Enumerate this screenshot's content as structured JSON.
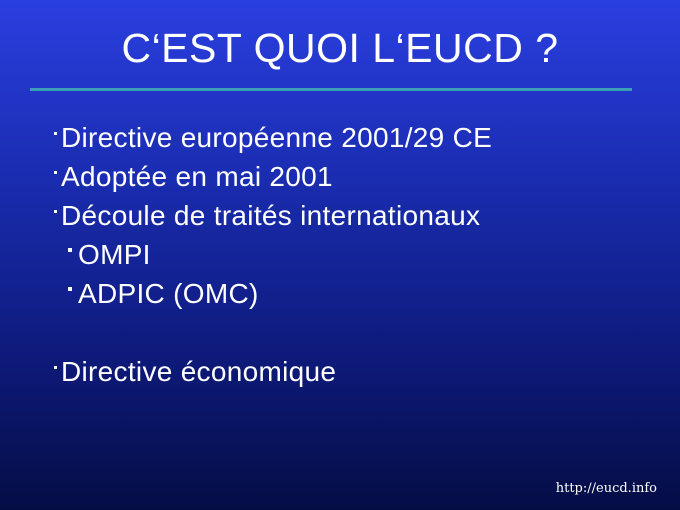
{
  "slide": {
    "title": "C‘EST QUOI L‘EUCD ?",
    "bullets": [
      {
        "text": "Directive européenne 2001/29 CE",
        "level": 1
      },
      {
        "text": "Adoptée en mai 2001",
        "level": 1
      },
      {
        "text": "Découle de traités internationaux",
        "level": 1
      },
      {
        "text": "OMPI",
        "level": 2
      },
      {
        "text": "ADPIC (OMC)",
        "level": 2
      },
      {
        "text": "Directive économique",
        "level": 1
      }
    ],
    "footer": "http://eucd.info"
  },
  "colors": {
    "background_top": "#2a3fe0",
    "background_bottom": "#050d45",
    "rule": "#3aa0b6",
    "text": "#ffffff"
  }
}
